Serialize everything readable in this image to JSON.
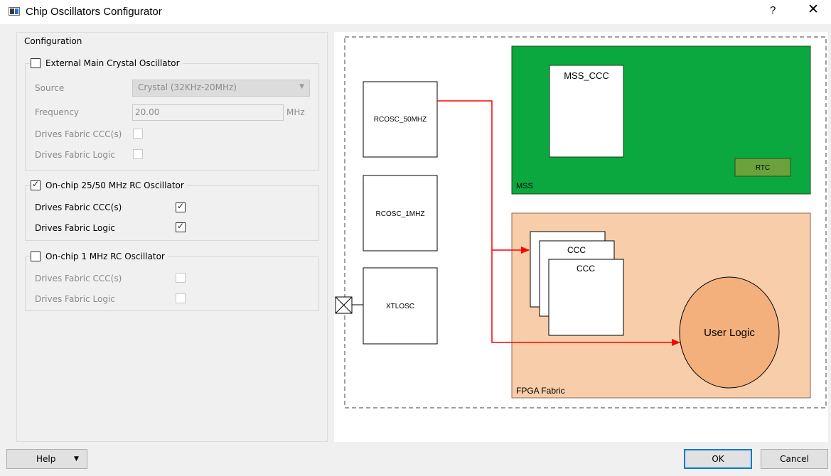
{
  "window": {
    "title": "Chip Oscillators Configurator",
    "help_glyph": "?",
    "close_glyph": "✕"
  },
  "config": {
    "section_title": "Configuration",
    "external": {
      "label": "External Main Crystal Oscillator",
      "checked": false,
      "source_label": "Source",
      "source_value": "Crystal (32KHz-20MHz)",
      "frequency_label": "Frequency",
      "frequency_value": "20.00",
      "frequency_unit": "MHz",
      "drives_ccc_label": "Drives Fabric CCC(s)",
      "drives_logic_label": "Drives Fabric Logic"
    },
    "rc50": {
      "label": "On-chip 25/50 MHz RC Oscillator",
      "checked": true,
      "drives_ccc_label": "Drives Fabric CCC(s)",
      "drives_ccc_checked": true,
      "drives_logic_label": "Drives Fabric Logic",
      "drives_logic_checked": true
    },
    "rc1": {
      "label": "On-chip 1 MHz RC Oscillator",
      "checked": false,
      "drives_ccc_label": "Drives Fabric CCC(s)",
      "drives_logic_label": "Drives Fabric Logic"
    }
  },
  "diagram": {
    "rcosc50": "RCOSC_50MHZ",
    "rcosc1": "RCOSC_1MHZ",
    "xtlosc": "XTLOSC",
    "mss_ccc": "MSS_CCC",
    "rtc": "RTC",
    "mss": "MSS",
    "ccc": "CCC",
    "user_logic": "User Logic",
    "fpga_fabric": "FPGA Fabric",
    "colors": {
      "mss_green": "#0aa83e",
      "fabric": "#f8cdaa",
      "user_logic": "#f4b07c",
      "arrow": "#ff0000",
      "rtc": "#6aa33b"
    }
  },
  "buttons": {
    "help": "Help",
    "ok": "OK",
    "cancel": "Cancel"
  }
}
